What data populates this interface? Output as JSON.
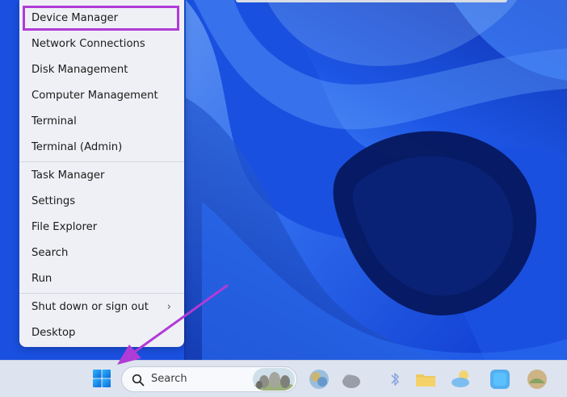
{
  "menu": {
    "items": [
      {
        "label": "Device Manager"
      },
      {
        "label": "Network Connections"
      },
      {
        "label": "Disk Management"
      },
      {
        "label": "Computer Management"
      },
      {
        "label": "Terminal"
      },
      {
        "label": "Terminal (Admin)"
      },
      {
        "label": "Task Manager"
      },
      {
        "label": "Settings"
      },
      {
        "label": "File Explorer"
      },
      {
        "label": "Search"
      },
      {
        "label": "Run"
      },
      {
        "label": "Shut down or sign out"
      },
      {
        "label": "Desktop"
      }
    ],
    "submenu_indicator": "›"
  },
  "taskbar": {
    "search_label": "Search",
    "icons": [
      "windows-start-icon",
      "search-icon",
      "copilot-icon",
      "widgets-icon",
      "bluetooth-icon",
      "file-explorer-icon",
      "weather-icon",
      "store-icon",
      "photos-icon"
    ]
  },
  "colors": {
    "highlight": "#b13bd6",
    "wallpaper": "#1547d6"
  }
}
